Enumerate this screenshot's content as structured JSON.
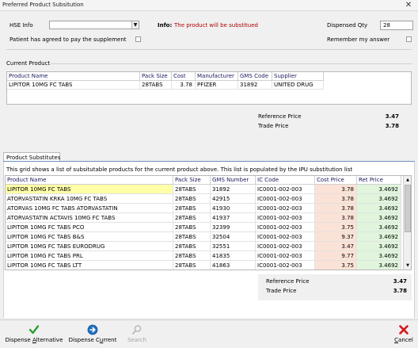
{
  "window": {
    "title": "Preferred Product Subsitution",
    "close_glyph": "✕"
  },
  "top": {
    "hse_label": "HSE Info",
    "hse_value": "",
    "info_label": "Info:",
    "info_text": "The product will be substitued",
    "dispensed_label": "Dispensed Qty",
    "dispensed_value": "28",
    "patient_agreed_label": "Patient has agreed to pay the supplement",
    "remember_label": "Remember my answer"
  },
  "current_product": {
    "group_label": "Current Product",
    "columns": [
      "Product Name",
      "Pack Size",
      "Cost",
      "Manufacturer",
      "GMS Code",
      "Supplier"
    ],
    "row": [
      "LIPITOR 10MG FC TABS",
      "28TABS",
      "3.78",
      "PFIZER",
      "31892",
      "UNITED DRUG"
    ],
    "reference_label": "Reference Price",
    "reference_value": "3.47",
    "trade_label": "Trade Price",
    "trade_value": "3.78"
  },
  "substitutes": {
    "tab_label": "Product Substitutes",
    "description": "This grid shows a list of subsitutable products for the current product above. This list is populated by the IPU substitution list",
    "columns": [
      "Product Name",
      "Pack Size",
      "GMS Number",
      "IC Code",
      "Cost Price",
      "Ret Price"
    ],
    "rows": [
      [
        "LIPITOR 10MG FC TABS",
        "28TABS",
        "31892",
        "IC0001-002-003",
        "3.78",
        "3.4692"
      ],
      [
        "ATORVASTATIN KRKA 10MG FC TABS",
        "28TABS",
        "42915",
        "IC0001-002-003",
        "3.78",
        "3.4692"
      ],
      [
        "ATORVAS 10MG FC TABS ATORVASTATIN",
        "28TABS",
        "41930",
        "IC0001-002-003",
        "3.78",
        "3.4692"
      ],
      [
        "ATORVASTATIN ACTAVIS 10MG FC TABS",
        "28TABS",
        "41937",
        "IC0001-002-003",
        "3.78",
        "3.4692"
      ],
      [
        "LIPITOR 10MG FC TABS PCO",
        "28TABS",
        "32399",
        "IC0001-002-003",
        "3.75",
        "3.4692"
      ],
      [
        "LIPITOR 10MG FC TABS B&S",
        "28TABS",
        "32504",
        "IC0001-002-003",
        "9.37",
        "3.4692"
      ],
      [
        "LIPITOR 10MG FC TABS EURODRUG",
        "28TABS",
        "32551",
        "IC0001-002-003",
        "3.47",
        "3.4692"
      ],
      [
        "LIPITOR 10MG FC TABS PRL",
        "28TABS",
        "41835",
        "IC0001-002-003",
        "9.77",
        "3.4692"
      ],
      [
        "LIPITOR 10MG FC TABS LTT",
        "28TABS",
        "41863",
        "IC0001-002-003",
        "3.75",
        "3.4692"
      ]
    ],
    "reference_label": "Reference Price",
    "reference_value": "3.47",
    "trade_label": "Trade Price",
    "trade_value": "3.78"
  },
  "actions": {
    "dispense_alternative": "Dispense Alternative",
    "dispense_current": "Dispense Current",
    "search": "Search",
    "cancel": "Cancel"
  },
  "colors": {
    "info_text": "#b00000",
    "selected_row": "#ffffa8",
    "cost_cell": "#fbe2d6",
    "ret_cell": "#e0f5dc"
  },
  "icons": [
    "check-icon",
    "arrow-right-circle-icon",
    "magnifier-icon",
    "red-x-icon"
  ]
}
